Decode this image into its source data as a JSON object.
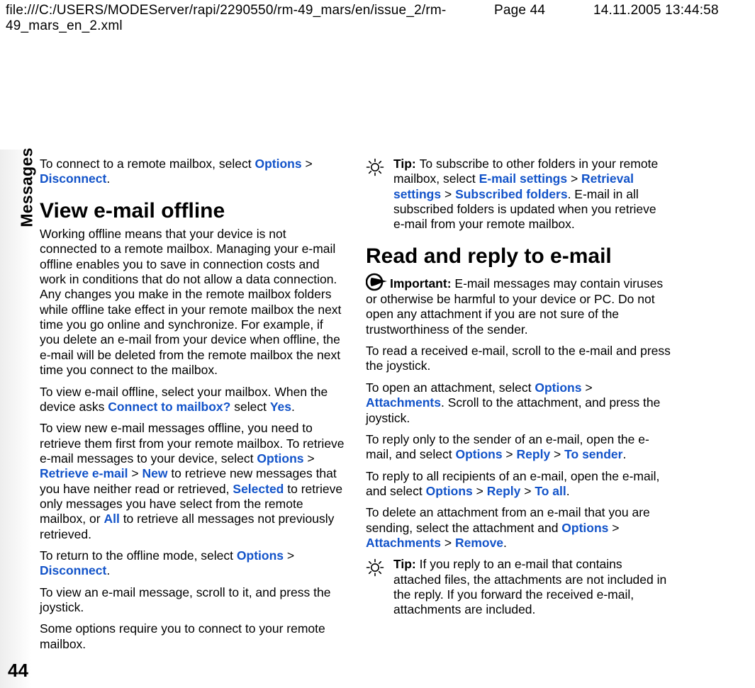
{
  "header": {
    "path": "file:///C:/USERS/MODEServer/rapi/2290550/rm-49_mars/en/issue_2/rm-49_mars_en_2.xml",
    "page": "Page 44",
    "datetime": "14.11.2005 13:44:58"
  },
  "sidebar": {
    "section_label": "Messages",
    "page_number": "44"
  },
  "left_column": {
    "p1_a": "To connect to a remote mailbox, select ",
    "p1_link1": "Options",
    "p1_gt1": " > ",
    "p1_link2": "Disconnect",
    "p1_b": ".",
    "h1": "View e-mail offline",
    "p2": "Working offline means that your device is not connected to a remote mailbox. Managing your e-mail offline enables you to save in connection costs and work in conditions that do not allow a data connection. Any changes you make in the remote mailbox folders while offline take effect in your remote mailbox the next time you go online and synchronize. For example, if you delete an e-mail from your device when offline, the e-mail will be deleted from the remote mailbox the next time you connect to the mailbox.",
    "p3_a": "To view e-mail offline, select your mailbox. When the device asks ",
    "p3_link1": "Connect to mailbox?",
    "p3_b": " select ",
    "p3_link2": "Yes",
    "p3_c": ".",
    "p4_a": "To view new e-mail messages offline, you need to retrieve them first from your remote mailbox. To retrieve e-mail messages to your device, select ",
    "p4_link1": "Options",
    "p4_gt1": " > ",
    "p4_link2": "Retrieve e-mail",
    "p4_gt2": " > ",
    "p4_link3": "New",
    "p4_b": " to retrieve new messages that you have neither read or retrieved, ",
    "p4_link4": "Selected",
    "p4_c": " to retrieve only messages you have select from the remote mailbox, or ",
    "p4_link5": "All",
    "p4_d": " to retrieve all messages not previously retrieved.",
    "p5_a": "To return to the offline mode, select ",
    "p5_link1": "Options",
    "p5_gt1": " > ",
    "p5_link2": "Disconnect",
    "p5_b": ".",
    "p6": "To view an e-mail message, scroll to it, and press the joystick.",
    "p7": "Some options require you to connect to your remote mailbox."
  },
  "right_column": {
    "tip1_label": "Tip: ",
    "tip1_a": "To subscribe to other folders in your remote mailbox, select ",
    "tip1_link1": "E-mail settings",
    "tip1_gt1": " > ",
    "tip1_link2": "Retrieval settings",
    "tip1_gt2": " > ",
    "tip1_link3": "Subscribed folders",
    "tip1_b": ". E-mail in all subscribed folders is updated when you retrieve e-mail from your remote mailbox.",
    "h1": "Read and reply to e-mail",
    "imp_label": "Important:  ",
    "imp_body": "E-mail messages may contain viruses or otherwise be harmful to your device or PC. Do not open any attachment if you are not sure of the trustworthiness of the sender.",
    "p1": "To read a received e-mail, scroll to the e-mail and press the joystick.",
    "p2_a": "To open an attachment, select ",
    "p2_link1": "Options",
    "p2_gt1": " > ",
    "p2_link2": "Attachments",
    "p2_b": ". Scroll to the attachment, and press the joystick.",
    "p3_a": "To reply only to the sender of an e-mail, open the e-mail, and select ",
    "p3_link1": "Options",
    "p3_gt1": " > ",
    "p3_link2": "Reply",
    "p3_gt2": " > ",
    "p3_link3": "To sender",
    "p3_b": ".",
    "p4_a": "To reply to all recipients of an e-mail, open the e-mail, and select ",
    "p4_link1": "Options",
    "p4_gt1": " > ",
    "p4_link2": "Reply",
    "p4_gt2": " > ",
    "p4_link3": "To all",
    "p4_b": ".",
    "p5_a": "To delete an attachment from an e-mail that you are sending, select the attachment and ",
    "p5_link1": "Options",
    "p5_gt1": " > ",
    "p5_link2": "Attachments",
    "p5_gt2": " > ",
    "p5_link3": "Remove",
    "p5_b": ".",
    "tip2_label": "Tip: ",
    "tip2_body": "If you reply to an e-mail that contains attached files, the attachments are not included in the reply. If you forward the received e-mail, attachments are included."
  }
}
